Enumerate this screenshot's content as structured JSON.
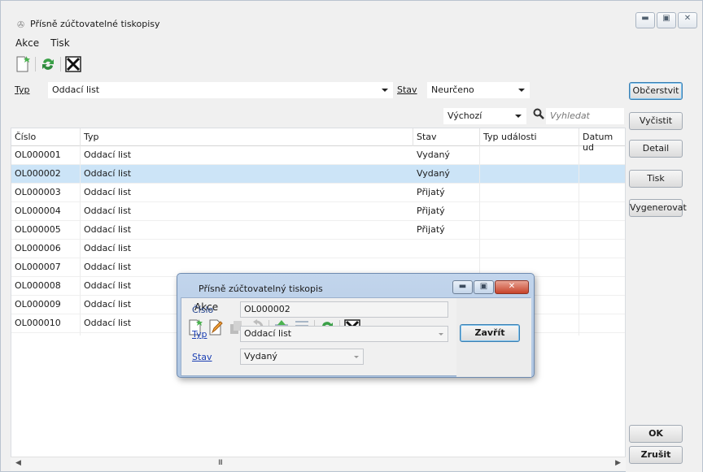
{
  "window": {
    "title": "Přísně zúčtovatelné tiskopisy",
    "controls": [
      "minimize",
      "maximize",
      "close"
    ]
  },
  "menu": [
    "Akce",
    "Tisk"
  ],
  "toolbar": [
    "new-doc-icon",
    "refresh-icon",
    "cancel-icon"
  ],
  "filter": {
    "type_label": "Typ",
    "type_value": "Oddací list",
    "state_label": "Stav",
    "state_value": "Neurčeno",
    "view_value": "Výchozí",
    "search_placeholder": "Vyhledat"
  },
  "grid": {
    "columns": [
      "Číslo",
      "Typ",
      "Stav",
      "Typ události",
      "Datum ud"
    ],
    "rows": [
      {
        "cislo": "OL000001",
        "typ": "Oddací list",
        "stav": "Vydaný"
      },
      {
        "cislo": "OL000002",
        "typ": "Oddací list",
        "stav": "Vydaný"
      },
      {
        "cislo": "OL000003",
        "typ": "Oddací list",
        "stav": "Přijatý"
      },
      {
        "cislo": "OL000004",
        "typ": "Oddací list",
        "stav": "Přijatý"
      },
      {
        "cislo": "OL000005",
        "typ": "Oddací list",
        "stav": "Přijatý"
      },
      {
        "cislo": "OL000006",
        "typ": "Oddací list",
        "stav": ""
      },
      {
        "cislo": "OL000007",
        "typ": "Oddací list",
        "stav": ""
      },
      {
        "cislo": "OL000008",
        "typ": "Oddací list",
        "stav": ""
      },
      {
        "cislo": "OL000009",
        "typ": "Oddací list",
        "stav": ""
      },
      {
        "cislo": "OL000010",
        "typ": "Oddací list",
        "stav": ""
      }
    ],
    "selected_index": 1
  },
  "side_buttons": {
    "refresh": "Občerstvit",
    "clear": "Vyčistit",
    "detail": "Detail",
    "print": "Tisk",
    "generate": "Vygenerovat",
    "ok": "OK",
    "cancel": "Zrušit"
  },
  "dialog": {
    "title": "Přísně zúčtovatelný tiskopis",
    "menu": "Akce",
    "fields": {
      "cislo_label": "Číslo",
      "cislo_value": "OL000002",
      "typ_label": "Typ",
      "typ_value": "Oddací list",
      "stav_label": "Stav",
      "stav_value": "Vydaný"
    },
    "close_button": "Zavřít"
  },
  "colors": {
    "selection": "#cce4f7",
    "dialog_frame": "#b5cbe6",
    "default_button_border": "#3c7fb1"
  }
}
